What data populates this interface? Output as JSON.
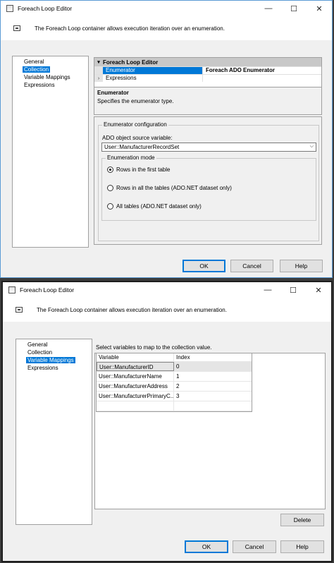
{
  "window_title": "Foreach Loop Editor",
  "description": "The Foreach Loop container allows execution iteration over an enumeration.",
  "window_controls": {
    "minimize": "—",
    "maximize": "☐",
    "close": "✕"
  },
  "nav_items": [
    "General",
    "Collection",
    "Variable Mappings",
    "Expressions"
  ],
  "dialog1": {
    "selected_nav": "Collection",
    "property_grid": {
      "category": "Foreach Loop Editor",
      "rows": [
        {
          "key": "Enumerator",
          "value": "Foreach ADO Enumerator"
        },
        {
          "key": "Expressions",
          "value": ""
        }
      ]
    },
    "help": {
      "title": "Enumerator",
      "text": "Specifies the enumerator type."
    },
    "config": {
      "group_label": "Enumerator configuration",
      "source_label": "ADO object source variable:",
      "source_value": "User::ManufacturerRecordSet",
      "mode_label": "Enumeration mode",
      "modes": [
        {
          "label": "Rows in the first table",
          "checked": true
        },
        {
          "label": "Rows in all the tables (ADO.NET dataset only)",
          "checked": false
        },
        {
          "label": "All tables (ADO.NET dataset only)",
          "checked": false
        }
      ]
    },
    "buttons": {
      "ok": "OK",
      "cancel": "Cancel",
      "help": "Help"
    }
  },
  "dialog2": {
    "selected_nav": "Variable Mappings",
    "instruction": "Select variables to map to the collection value.",
    "columns": [
      "Variable",
      "Index"
    ],
    "rows": [
      {
        "variable": "User::ManufacturerID",
        "index": "0"
      },
      {
        "variable": "User::ManufacturerName",
        "index": "1"
      },
      {
        "variable": "User::ManufacturerAddress",
        "index": "2"
      },
      {
        "variable": "User::ManufacturerPrimaryC...",
        "index": "3"
      }
    ],
    "delete_label": "Delete",
    "buttons": {
      "ok": "OK",
      "cancel": "Cancel",
      "help": "Help"
    }
  }
}
